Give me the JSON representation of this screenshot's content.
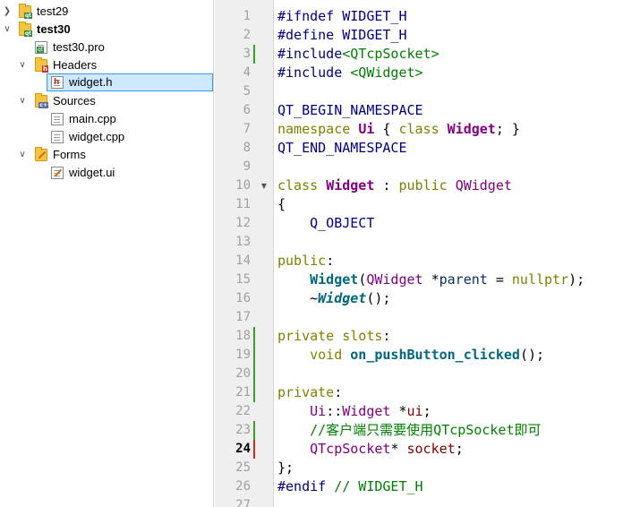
{
  "project_tree": {
    "nodes": [
      {
        "id": "test29",
        "label": "test29",
        "expanded": false,
        "bold": false
      },
      {
        "id": "test30",
        "label": "test30",
        "expanded": true,
        "bold": true
      },
      {
        "id": "pro",
        "label": "test30.pro"
      },
      {
        "id": "headers",
        "label": "Headers",
        "expanded": true
      },
      {
        "id": "widget_h",
        "label": "widget.h",
        "selected": true
      },
      {
        "id": "sources",
        "label": "Sources",
        "expanded": true
      },
      {
        "id": "main_cpp",
        "label": "main.cpp"
      },
      {
        "id": "widget_cpp",
        "label": "widget.cpp"
      },
      {
        "id": "forms",
        "label": "Forms",
        "expanded": true
      },
      {
        "id": "widget_ui",
        "label": "widget.ui"
      }
    ],
    "icons": {
      "folder_badge": "qt",
      "header_badge": "h",
      "sources_badge": "c++"
    },
    "colors": {
      "selection_bg": "#cde8ff",
      "selection_border": "#3399ff"
    }
  },
  "editor": {
    "current_line": "24",
    "lines": [
      {
        "n": "1",
        "t": [
          {
            "c": "pp",
            "v": "#ifndef WIDGET_H"
          }
        ]
      },
      {
        "n": "2",
        "t": [
          {
            "c": "pp",
            "v": "#define WIDGET_H"
          }
        ]
      },
      {
        "n": "3",
        "t": [
          {
            "c": "pp",
            "v": "#include"
          },
          {
            "c": "str",
            "v": "<QTcpSocket>"
          }
        ],
        "marker": "green"
      },
      {
        "n": "4",
        "t": [
          {
            "c": "pp",
            "v": "#include "
          },
          {
            "c": "str",
            "v": "<QWidget>"
          }
        ]
      },
      {
        "n": "5",
        "t": []
      },
      {
        "n": "6",
        "t": [
          {
            "c": "macro",
            "v": "QT_BEGIN_NAMESPACE"
          }
        ]
      },
      {
        "n": "7",
        "t": [
          {
            "c": "kw",
            "v": "namespace"
          },
          {
            "c": "plain",
            "v": " "
          },
          {
            "c": "name",
            "v": "Ui"
          },
          {
            "c": "plain",
            "v": " { "
          },
          {
            "c": "kw",
            "v": "class"
          },
          {
            "c": "plain",
            "v": " "
          },
          {
            "c": "name",
            "v": "Widget"
          },
          {
            "c": "plain",
            "v": "; }"
          }
        ]
      },
      {
        "n": "8",
        "t": [
          {
            "c": "macro",
            "v": "QT_END_NAMESPACE"
          }
        ]
      },
      {
        "n": "9",
        "t": []
      },
      {
        "n": "10",
        "t": [
          {
            "c": "kw",
            "v": "class"
          },
          {
            "c": "plain",
            "v": " "
          },
          {
            "c": "name",
            "v": "Widget"
          },
          {
            "c": "plain",
            "v": " : "
          },
          {
            "c": "kw",
            "v": "public"
          },
          {
            "c": "plain",
            "v": " "
          },
          {
            "c": "ty",
            "v": "QWidget"
          }
        ],
        "fold": true
      },
      {
        "n": "11",
        "t": [
          {
            "c": "plain",
            "v": "{"
          }
        ]
      },
      {
        "n": "12",
        "t": [
          {
            "c": "plain",
            "v": "    "
          },
          {
            "c": "macro",
            "v": "Q_OBJECT"
          }
        ]
      },
      {
        "n": "13",
        "t": []
      },
      {
        "n": "14",
        "t": [
          {
            "c": "kw",
            "v": "public"
          },
          {
            "c": "plain",
            "v": ":"
          }
        ]
      },
      {
        "n": "15",
        "t": [
          {
            "c": "plain",
            "v": "    "
          },
          {
            "c": "fn",
            "v": "Widget"
          },
          {
            "c": "plain",
            "v": "("
          },
          {
            "c": "ty",
            "v": "QWidget"
          },
          {
            "c": "plain",
            "v": " *"
          },
          {
            "c": "param",
            "v": "parent"
          },
          {
            "c": "plain",
            "v": " = "
          },
          {
            "c": "kw",
            "v": "nullptr"
          },
          {
            "c": "plain",
            "v": ");"
          }
        ]
      },
      {
        "n": "16",
        "t": [
          {
            "c": "plain",
            "v": "    ~"
          },
          {
            "c": "dtor",
            "v": "Widget"
          },
          {
            "c": "plain",
            "v": "();"
          }
        ]
      },
      {
        "n": "17",
        "t": []
      },
      {
        "n": "18",
        "t": [
          {
            "c": "kw",
            "v": "private"
          },
          {
            "c": "plain",
            "v": " "
          },
          {
            "c": "kw",
            "v": "slots"
          },
          {
            "c": "plain",
            "v": ":"
          }
        ],
        "marker": "green"
      },
      {
        "n": "19",
        "t": [
          {
            "c": "plain",
            "v": "    "
          },
          {
            "c": "kw",
            "v": "void"
          },
          {
            "c": "plain",
            "v": " "
          },
          {
            "c": "fn",
            "v": "on_pushButton_clicked"
          },
          {
            "c": "plain",
            "v": "();"
          }
        ],
        "marker": "green"
      },
      {
        "n": "20",
        "t": [],
        "marker": "green"
      },
      {
        "n": "21",
        "t": [
          {
            "c": "kw",
            "v": "private"
          },
          {
            "c": "plain",
            "v": ":"
          }
        ],
        "marker": "green"
      },
      {
        "n": "22",
        "t": [
          {
            "c": "plain",
            "v": "    "
          },
          {
            "c": "ty",
            "v": "Ui"
          },
          {
            "c": "plain",
            "v": "::"
          },
          {
            "c": "ty",
            "v": "Widget"
          },
          {
            "c": "plain",
            "v": " *"
          },
          {
            "c": "field",
            "v": "ui"
          },
          {
            "c": "plain",
            "v": ";"
          }
        ]
      },
      {
        "n": "23",
        "t": [
          {
            "c": "plain",
            "v": "    "
          },
          {
            "c": "cm",
            "v": "//客户端只需要使用QTcpSocket即可"
          }
        ],
        "marker": "green"
      },
      {
        "n": "24",
        "t": [
          {
            "c": "plain",
            "v": "    "
          },
          {
            "c": "ty",
            "v": "QTcpSocket"
          },
          {
            "c": "plain",
            "v": "* "
          },
          {
            "c": "field",
            "v": "socket"
          },
          {
            "c": "plain",
            "v": ";"
          }
        ],
        "marker": "red"
      },
      {
        "n": "25",
        "t": [
          {
            "c": "plain",
            "v": "};"
          }
        ]
      },
      {
        "n": "26",
        "t": [
          {
            "c": "pp",
            "v": "#endif"
          },
          {
            "c": "plain",
            "v": " "
          },
          {
            "c": "cm",
            "v": "// WIDGET_H"
          }
        ]
      },
      {
        "n": "27",
        "t": []
      }
    ]
  }
}
